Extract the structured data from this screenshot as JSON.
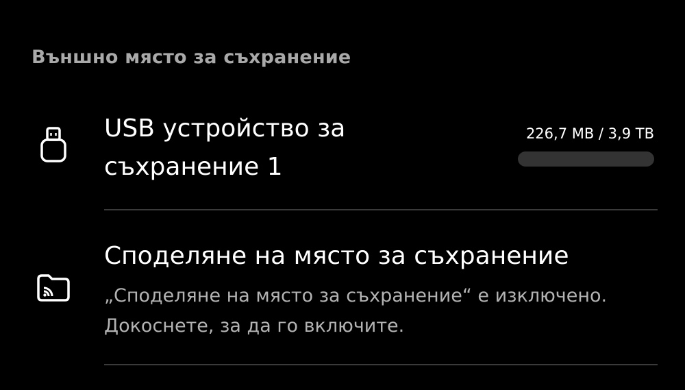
{
  "section": {
    "title": "Външно място за съхранение"
  },
  "usb_storage": {
    "title": "USB устройство за съхранение 1",
    "size_text": "226,7 MB / 3,9 TB",
    "usage_fraction": 0.0001,
    "icon": "usb-drive-icon"
  },
  "storage_sharing": {
    "title": "Споделяне на място за съхранение",
    "summary": "„Споделяне на място за съхранение“ е изключено. Докоснете, за да го включите.",
    "icon": "folder-cast-icon"
  },
  "colors": {
    "background": "#000000",
    "header_text": "#a9a9a9",
    "primary_text": "#ffffff",
    "secondary_text": "#b3b3b3",
    "progress_track": "#333333",
    "divider": "#3a3a3a"
  }
}
